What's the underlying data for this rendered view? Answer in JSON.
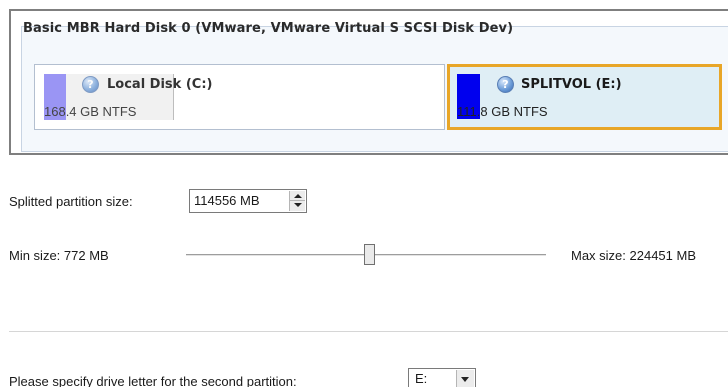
{
  "disk": {
    "title": "Basic MBR Hard Disk 0 (VMware, VMware Virtual S SCSI Disk Dev)",
    "partitions": [
      {
        "name": "Local Disk (C:)",
        "size": "168.4 GB NTFS",
        "color": "#9a95f4",
        "icon": "question-disk-icon",
        "selected": false
      },
      {
        "name": "SPLITVOL (E:)",
        "size": "111.8 GB NTFS",
        "color": "#0000ee",
        "icon": "question-disk-icon",
        "selected": true,
        "highlight_color": "#e8a628"
      }
    ]
  },
  "split": {
    "label": "Splitted partition size:",
    "value": "114556 MB",
    "min_label": "Min size: 772 MB",
    "max_label": "Max size: 224451 MB",
    "min_mb": 772,
    "max_mb": 224451,
    "value_mb": 114556
  },
  "drive_letter": {
    "label": "Please specify drive letter for the second partition:",
    "selected": "E:"
  }
}
